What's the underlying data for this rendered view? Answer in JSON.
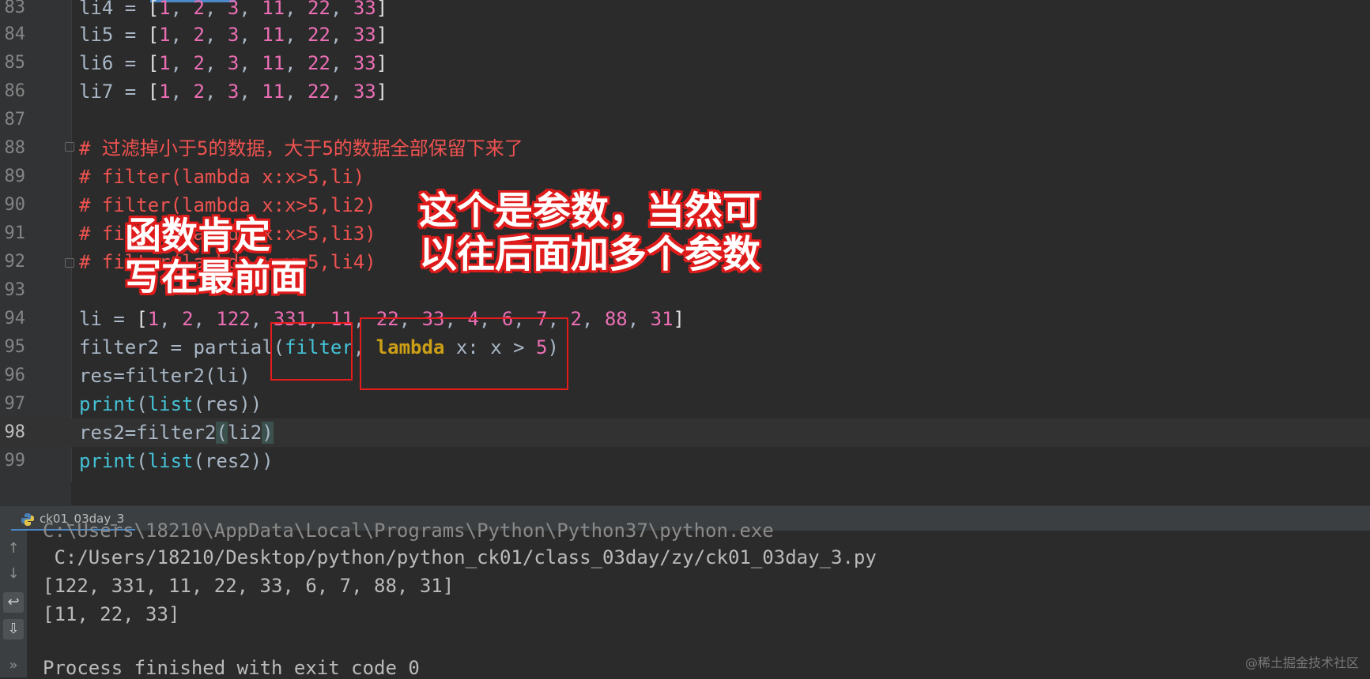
{
  "editor": {
    "lines": [
      {
        "num": "83",
        "text": "li4 = [1, 2, 3, 11, 22, 33]"
      },
      {
        "num": "84",
        "text": "li5 = [1, 2, 3, 11, 22, 33]"
      },
      {
        "num": "85",
        "text": "li6 = [1, 2, 3, 11, 22, 33]"
      },
      {
        "num": "86",
        "text": "li7 = [1, 2, 3, 11, 22, 33]"
      },
      {
        "num": "87",
        "text": ""
      },
      {
        "num": "88",
        "text": "# 过滤掉小于5的数据，大于5的数据全部保留下来了"
      },
      {
        "num": "89",
        "text": "# filter(lambda x:x>5,li)"
      },
      {
        "num": "90",
        "text": "# filter(lambda x:x>5,li2)"
      },
      {
        "num": "91",
        "text": "# filter(lambda x:x>5,li3)"
      },
      {
        "num": "92",
        "text": "# filter(lambda x:x>5,li4)"
      },
      {
        "num": "93",
        "text": ""
      },
      {
        "num": "94",
        "text": "li = [1, 2, 122, 331, 11, 22, 33, 4, 6, 7, 2, 88, 31]"
      },
      {
        "num": "95",
        "text": "filter2 = partial(filter, lambda x: x > 5)"
      },
      {
        "num": "96",
        "text": "res=filter2(li)"
      },
      {
        "num": "97",
        "text": "print(list(res))"
      },
      {
        "num": "98",
        "text": "res2=filter2(li2)"
      },
      {
        "num": "99",
        "text": "print(list(res2))"
      }
    ]
  },
  "run_panel": {
    "tab_label": "ck01_03day_3",
    "output": [
      "C:\\Users\\18210\\AppData\\Local\\Programs\\Python\\Python37\\python.exe",
      " C:/Users/18210/Desktop/python/python_ck01/class_03day/zy/ck01_03day_3.py",
      "[122, 331, 11, 22, 33, 6, 7, 88, 31]",
      "[11, 22, 33]",
      "",
      "Process finished with exit code 0"
    ]
  },
  "annotations": {
    "left_note": "函数肯定\n写在最前面",
    "right_note": "这个是参数，当然可\n以往后面加多个参数"
  },
  "watermark": "@稀土掘金技术社区",
  "colors": {
    "background": "#2b2b2b",
    "gutter": "#313335",
    "number": "#ec6fb5",
    "comment": "#ef5350",
    "builtin": "#44c2d6",
    "keyword": "#cc9f16",
    "annotation_red": "#e51c1c"
  }
}
